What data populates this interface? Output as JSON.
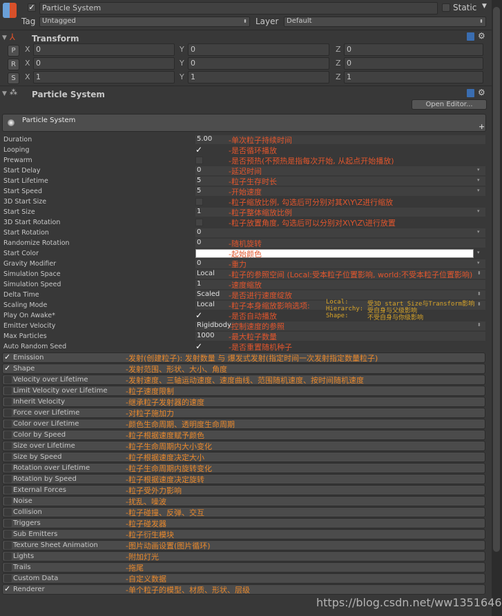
{
  "header": {
    "name": "Particle System",
    "active": true,
    "static_label": "Static",
    "tag_label": "Tag",
    "tag_value": "Untagged",
    "layer_label": "Layer",
    "layer_value": "Default"
  },
  "transform": {
    "title": "Transform",
    "rows": [
      {
        "btn": "P",
        "x": "0",
        "y": "0",
        "z": "0"
      },
      {
        "btn": "R",
        "x": "0",
        "y": "0",
        "z": "0"
      },
      {
        "btn": "S",
        "x": "1",
        "y": "1",
        "z": "1"
      }
    ],
    "axes": [
      "X",
      "Y",
      "Z"
    ]
  },
  "particle_component": {
    "title": "Particle System",
    "open_editor": "Open Editor...",
    "module_title": "Particle System"
  },
  "colors": {
    "note_main": "#e2562d",
    "note_module": "#e8882c",
    "note_sub": "#d8a428",
    "start_color": "#ffffff"
  },
  "properties": [
    {
      "label": "Duration",
      "value": "5.00",
      "kind": "text",
      "arrow": "",
      "note": "-单次粒子持续时间"
    },
    {
      "label": "Looping",
      "value": "✓",
      "kind": "check",
      "arrow": "",
      "note": "-是否循环播放"
    },
    {
      "label": "Prewarm",
      "value": "",
      "kind": "uncheck",
      "arrow": "",
      "note": "-是否预热(不预热是指每次开始, 从起点开始播放)"
    },
    {
      "label": "Start Delay",
      "value": "0",
      "kind": "text",
      "arrow": "▾",
      "note": "-延迟时间"
    },
    {
      "label": "Start Lifetime",
      "value": "5",
      "kind": "text",
      "arrow": "▾",
      "note": "-粒子生存时长"
    },
    {
      "label": "Start Speed",
      "value": "5",
      "kind": "text",
      "arrow": "▾",
      "note": "-开始速度"
    },
    {
      "label": "3D Start Size",
      "value": "",
      "kind": "uncheck",
      "arrow": "",
      "note": "-粒子缩放比例, 勾选后可分别对其X\\Y\\Z进行缩放"
    },
    {
      "label": "Start Size",
      "value": "1",
      "kind": "text",
      "arrow": "▾",
      "note": "-粒子整体缩放比例"
    },
    {
      "label": "3D Start Rotation",
      "value": "",
      "kind": "uncheck",
      "arrow": "",
      "note": "-粒子放置角度, 勾选后可以分别对X\\Y\\Z\\进行放置"
    },
    {
      "label": "Start Rotation",
      "value": "0",
      "kind": "text",
      "arrow": "▾",
      "note": ""
    },
    {
      "label": "Randomize Rotation",
      "value": "0",
      "kind": "text",
      "arrow": "",
      "note": "-随机旋转"
    },
    {
      "label": "Start Color",
      "value": "",
      "kind": "color",
      "arrow": "▾",
      "note": "-起始颜色"
    },
    {
      "label": "Gravity Modifier",
      "value": "0",
      "kind": "text",
      "arrow": "▾",
      "note": "-重力"
    },
    {
      "label": "Simulation Space",
      "value": "Local",
      "kind": "text",
      "arrow": "⬍",
      "note": "-粒子的参照空间 (Local:受本粒子位置影响, world:不受本粒子位置影响)"
    },
    {
      "label": "Simulation Speed",
      "value": "1",
      "kind": "text",
      "arrow": "",
      "note": "-速度缩放"
    },
    {
      "label": "Delta Time",
      "value": "Scaled",
      "kind": "text",
      "arrow": "⬍",
      "note": "-是否进行速度绽放"
    },
    {
      "label": "Scaling Mode",
      "value": "Local",
      "kind": "text",
      "arrow": "⬍",
      "note": "-粒子本身缩放影响选项:"
    },
    {
      "label": "Play On Awake*",
      "value": "✓",
      "kind": "check",
      "arrow": "",
      "note": "-是否自动播放"
    },
    {
      "label": "Emitter Velocity",
      "value": "Rigidbody",
      "kind": "text",
      "arrow": "⬍",
      "note": "-控制速度的参照"
    },
    {
      "label": "Max Particles",
      "value": "1000",
      "kind": "text",
      "arrow": "",
      "note": "-最大粒子数量"
    },
    {
      "label": "Auto Random Seed",
      "value": "✓",
      "kind": "check",
      "arrow": "",
      "note": "-是否重置随机种子"
    }
  ],
  "scaling_notes": [
    {
      "key": "Local:",
      "text": "受3D start Size与Transform影响"
    },
    {
      "key": "Hierarchy:",
      "text": "受自身与父级影响"
    },
    {
      "key": "Shape:",
      "text": "不受自身与你级影响"
    }
  ],
  "modules": [
    {
      "label": "Emission",
      "enabled": true,
      "note": "-发射(创建粒子): 发射数量 与 爆发式发射(指定时间一次发射指定数量粒子)"
    },
    {
      "label": "Shape",
      "enabled": true,
      "note": "-发射范围、形状、大小、角度"
    },
    {
      "label": "Velocity over Lifetime",
      "enabled": false,
      "note": "-发射速度、三轴运动速度、速度曲线、范围随机速度、按时间随机速度"
    },
    {
      "label": "Limit Velocity over Lifetime",
      "enabled": false,
      "note": "-粒子速度限制"
    },
    {
      "label": "Inherit Velocity",
      "enabled": false,
      "note": "-继承粒子发射器的速度"
    },
    {
      "label": "Force over Lifetime",
      "enabled": false,
      "note": "-对粒子施加力"
    },
    {
      "label": "Color over Lifetime",
      "enabled": false,
      "note": "-颜色生命周期、透明度生命周期"
    },
    {
      "label": "Color by Speed",
      "enabled": false,
      "note": "-粒子根据速度赋予颜色"
    },
    {
      "label": "Size over Lifetime",
      "enabled": false,
      "note": "-粒子生命周期内大小变化"
    },
    {
      "label": "Size by Speed",
      "enabled": false,
      "note": "-粒子根据速度决定大小"
    },
    {
      "label": "Rotation over Lifetime",
      "enabled": false,
      "note": "-粒子生命周期内旋转变化"
    },
    {
      "label": "Rotation by Speed",
      "enabled": false,
      "note": "-粒子根据速度决定旋转"
    },
    {
      "label": "External Forces",
      "enabled": false,
      "note": "-粒子受外力影响"
    },
    {
      "label": "Noise",
      "enabled": false,
      "note": "-扰乱、噪波"
    },
    {
      "label": "Collision",
      "enabled": false,
      "note": "-粒子碰撞、反弹、交互"
    },
    {
      "label": "Triggers",
      "enabled": false,
      "note": "-粒子碰发器"
    },
    {
      "label": "Sub Emitters",
      "enabled": false,
      "note": "-粒子衍生模块"
    },
    {
      "label": "Texture Sheet Animation",
      "enabled": false,
      "note": "-图片动画设置(图片循环)"
    },
    {
      "label": "Lights",
      "enabled": false,
      "note": "-附加灯光"
    },
    {
      "label": "Trails",
      "enabled": false,
      "note": "-拖尾"
    },
    {
      "label": "Custom Data",
      "enabled": false,
      "note": "-自定义数据"
    },
    {
      "label": "Renderer",
      "enabled": true,
      "note": "-单个粒子的模型、材质、形状、层级"
    }
  ],
  "watermark": "https://blog.csdn.net/ww1351646544"
}
